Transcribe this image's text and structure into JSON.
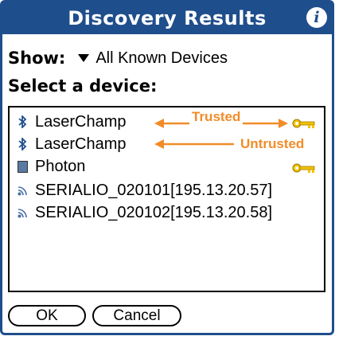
{
  "title": "Discovery Results",
  "show": {
    "label": "Show:",
    "value": "All Known Devices"
  },
  "select_label": "Select a device:",
  "devices": [
    {
      "icon": "bluetooth-icon",
      "label": "LaserChamp",
      "key": true
    },
    {
      "icon": "bluetooth-icon",
      "label": "LaserChamp",
      "key": false
    },
    {
      "icon": "computer-icon",
      "label": "Photon",
      "key": true
    },
    {
      "icon": "network-icon",
      "label": "SERIALIO_020101[195.13.20.57]",
      "key": false
    },
    {
      "icon": "network-icon",
      "label": "SERIALIO_020102[195.13.20.58]",
      "key": false
    }
  ],
  "annotations": {
    "trusted": "Trusted",
    "untrusted": "Untrusted",
    "color": "#f28c28"
  },
  "buttons": {
    "ok": "OK",
    "cancel": "Cancel"
  },
  "colors": {
    "title_bar": "#1f4e8c",
    "accent": "#f28c28",
    "key": "#f2c200"
  }
}
